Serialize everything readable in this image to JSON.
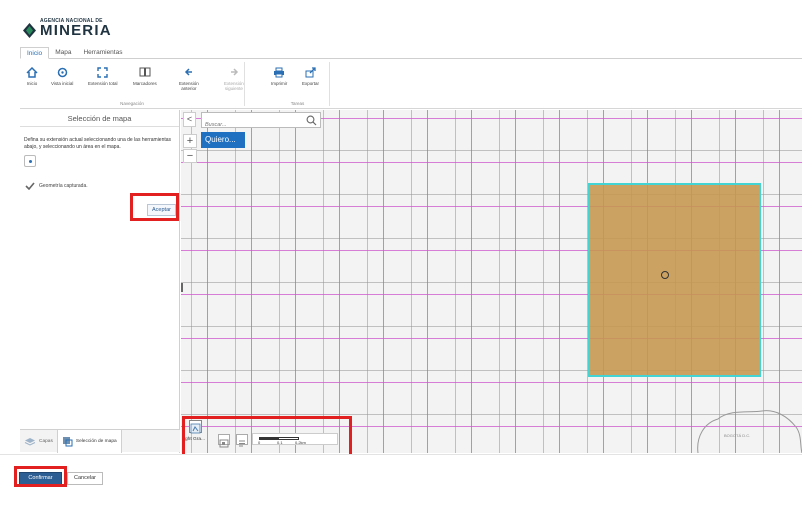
{
  "logo": {
    "small_text": "AGENCIA NACIONAL DE",
    "big_text": "MINERIA"
  },
  "ribbon": {
    "tabs": [
      {
        "label": "Inicio",
        "active": true
      },
      {
        "label": "Mapa",
        "active": false
      },
      {
        "label": "Herramientas",
        "active": false
      }
    ],
    "groups": {
      "navegacion": {
        "label": "Navegación",
        "buttons": [
          {
            "label": "Inicio",
            "icon": "home-icon"
          },
          {
            "label": "Vista inicial",
            "icon": "refresh-icon"
          },
          {
            "label": "Extensión total",
            "icon": "expand-icon"
          },
          {
            "label": "Marcadores",
            "icon": "book-icon"
          },
          {
            "label": "Extensión\nanterior",
            "icon": "back-arrow-icon"
          },
          {
            "label": "Extensión\nsiguiente",
            "icon": "forward-arrow-icon",
            "disabled": true
          }
        ]
      },
      "tareas": {
        "label": "Tareas",
        "buttons": [
          {
            "label": "Imprimir",
            "icon": "printer-icon"
          },
          {
            "label": "Exportar",
            "icon": "export-icon"
          }
        ]
      }
    }
  },
  "panel": {
    "title": "Selección de mapa",
    "description": "Defina su extensión actual seleccionando una de las herramientas abajo, y seleccionando un área en el mapa.",
    "captured_label": "Geometría capturada.",
    "accept_label": "Aceptar",
    "tabs": [
      {
        "label": "Capas",
        "icon": "layers-icon"
      },
      {
        "label": "Selección de mapa",
        "icon": "map-selection-icon",
        "active": true
      }
    ]
  },
  "map": {
    "search_placeholder": "Buscar...",
    "quiero_label": "Quiero...",
    "zoom_in_label": "+",
    "zoom_out_label": "−",
    "collapse_label": "<",
    "basemap_label": "ght Gra...",
    "scale_labels": [
      "0",
      "0.1",
      "0.2km"
    ],
    "terrain_label": "BOGOTÁ D.C."
  },
  "footer": {
    "confirm_label": "Confirmar",
    "cancel_label": "Cancelar"
  },
  "colors": {
    "accent": "#1f70c1",
    "selection_fill": "#c6964e",
    "selection_border": "#42d4d4",
    "highlight_red": "#e32020",
    "grid_magenta": "#cd55cd"
  }
}
